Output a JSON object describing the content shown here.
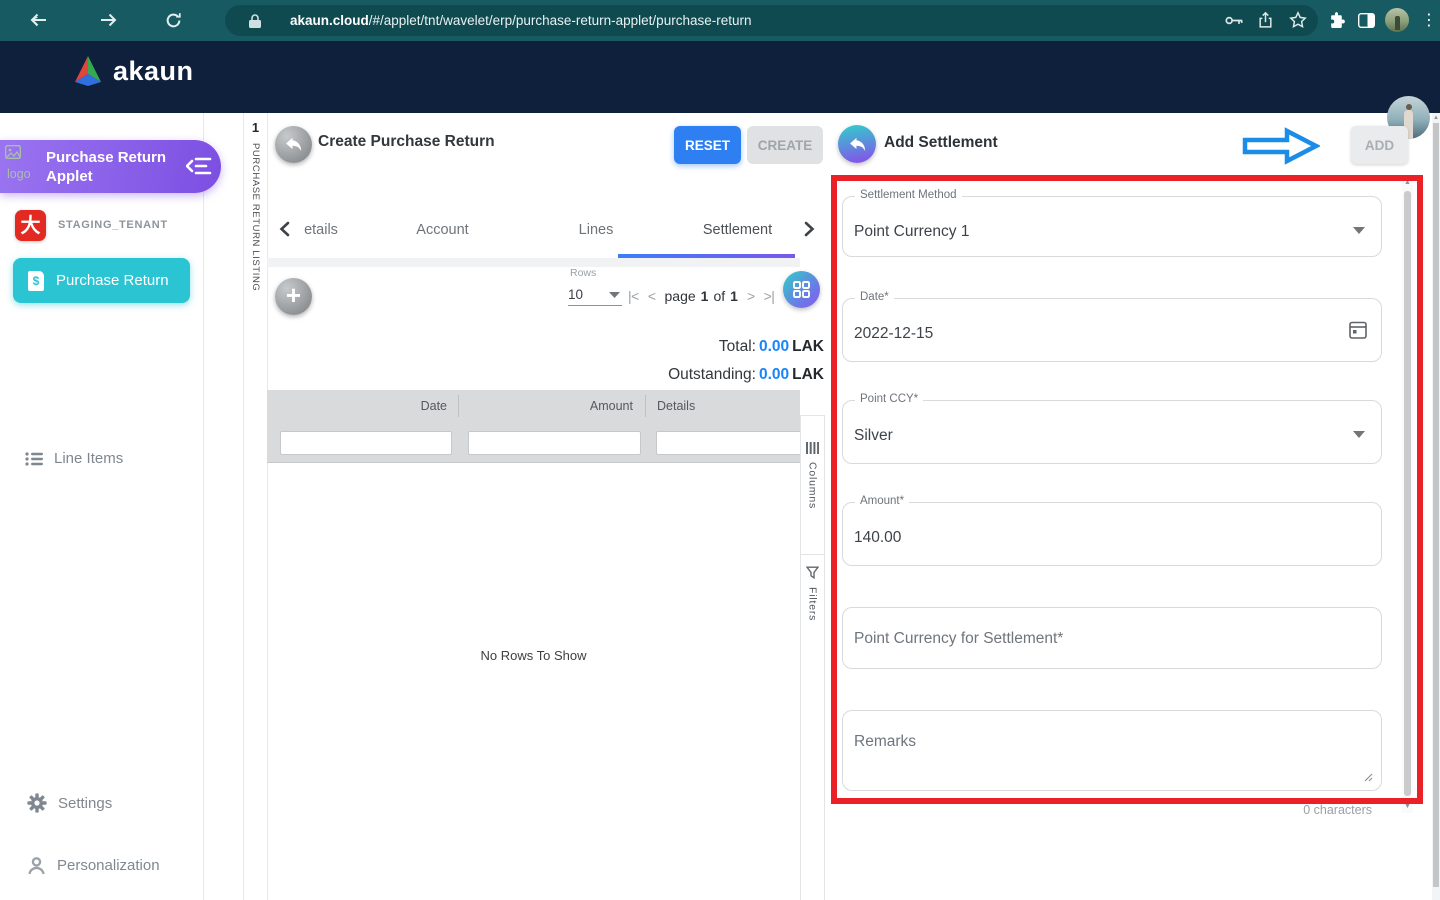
{
  "browser": {
    "url_domain": "akaun.cloud",
    "url_path": "/#/applet/tnt/wavelet/erp/purchase-return-applet/purchase-return"
  },
  "app_header": {
    "brand": "akaun"
  },
  "sidebar": {
    "applet_logo_alt": "logo",
    "applet_title": "Purchase Return Applet",
    "tenant_glyph": "大",
    "tenant_label": "STAGING_TENANT",
    "items": [
      {
        "label": "Purchase Return"
      },
      {
        "label": "Line Items"
      },
      {
        "label": "Settings"
      },
      {
        "label": "Personalization"
      }
    ]
  },
  "listing_strip": {
    "badge": "1",
    "label": "PURCHASE RETURN LISTING"
  },
  "main": {
    "title": "Create Purchase Return",
    "buttons": {
      "reset": "RESET",
      "create": "CREATE"
    },
    "tabs": {
      "items": [
        "etails",
        "Account",
        "Lines",
        "Settlement"
      ],
      "active": "Settlement"
    },
    "toolbar": {
      "rows_label": "Rows",
      "rows_value": "10",
      "first": "|<",
      "prev": "<",
      "page_word": "page",
      "page_num": "1",
      "of_word": "of",
      "total_pages": "1",
      "next": ">",
      "last": ">|"
    },
    "totals": [
      {
        "label": "Total:",
        "value": "0.00",
        "currency": "LAK"
      },
      {
        "label": "Outstanding:",
        "value": "0.00",
        "currency": "LAK"
      }
    ],
    "table": {
      "columns": [
        "Date",
        "Amount",
        "Details"
      ],
      "empty": "No Rows To Show"
    },
    "tools": {
      "columns": "Columns",
      "filters": "Filters"
    }
  },
  "panel": {
    "title": "Add Settlement",
    "add": "ADD",
    "fields": {
      "settlement_method": {
        "label": "Settlement Method",
        "value": "Point Currency 1"
      },
      "date": {
        "label": "Date*",
        "value": "2022-12-15"
      },
      "point_ccy": {
        "label": "Point CCY*",
        "value": "Silver"
      },
      "amount": {
        "label": "Amount*",
        "value": "140.00"
      },
      "point_currency_settlement": {
        "placeholder": "Point Currency for Settlement*"
      },
      "remarks": {
        "placeholder": "Remarks"
      }
    },
    "char_count": "0 characters"
  },
  "colors": {
    "browser_teal": "#175a61",
    "header_navy": "#0e203c",
    "accent_teal": "#2ac4d3",
    "accent_purple": "#8a5fe8",
    "primary_blue": "#2e80f2",
    "amount_blue": "#1a85f8",
    "annotation_red": "#ea2127",
    "annotation_blue": "#1b8ce8"
  }
}
